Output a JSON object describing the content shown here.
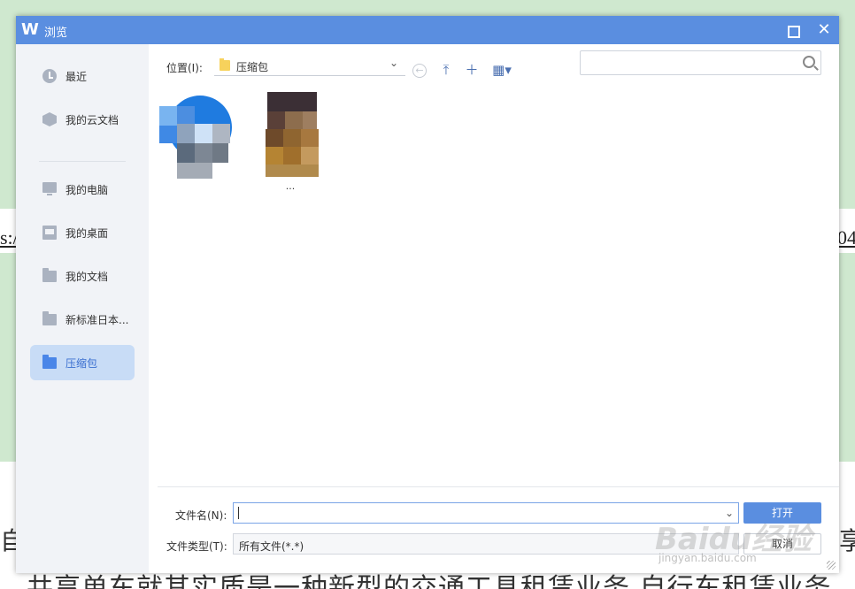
{
  "background": {
    "link_left": "s:/",
    "link_right": "04",
    "char_left": "自",
    "char_right": "享",
    "text_line": "共享单车就其实质是一种新型的交通工具租赁业务,自行车租赁业务"
  },
  "dialog": {
    "title": "浏览",
    "logo_glyph": "W",
    "maximize_label": "",
    "close_glyph": "✕"
  },
  "sidebar": {
    "items": [
      {
        "label": "最近",
        "icon": "clock-icon"
      },
      {
        "label": "我的云文档",
        "icon": "cloud-cube-icon"
      },
      {
        "label": "我的电脑",
        "icon": "monitor-icon"
      },
      {
        "label": "我的桌面",
        "icon": "desktop-icon"
      },
      {
        "label": "我的文档",
        "icon": "folder-icon"
      },
      {
        "label": "新标准日本...",
        "icon": "folder-icon"
      },
      {
        "label": "压缩包",
        "icon": "folder-icon",
        "active": true
      }
    ]
  },
  "toolbar": {
    "location_label": "位置(I):",
    "location_value": "压缩包",
    "chevron": "⌄",
    "back_glyph": "←",
    "up_glyph": "⤒",
    "new_folder_glyph": "＋",
    "view_glyph": "▦▾"
  },
  "search": {
    "placeholder": "",
    "value": ""
  },
  "files": [
    {
      "name": "",
      "thumb": "blurred-app-icon"
    },
    {
      "name": "...",
      "thumb": "blurred-photo"
    }
  ],
  "form": {
    "filename_label": "文件名(N):",
    "filename_value": "",
    "filename_dd": "⌄",
    "filetype_label": "文件类型(T):",
    "filetype_value": "所有文件(*.*)",
    "open_label": "打开",
    "cancel_label": "取消"
  },
  "watermark": {
    "text": "Baidu经验",
    "sub": "jingyan.baidu.com"
  },
  "colors": {
    "titlebar": "#5a8ee0",
    "accent": "#4a86e8",
    "sidebar_bg": "#f1f3f7",
    "active_item_bg": "#c8dcf6",
    "page_green": "#cfe8cf"
  }
}
